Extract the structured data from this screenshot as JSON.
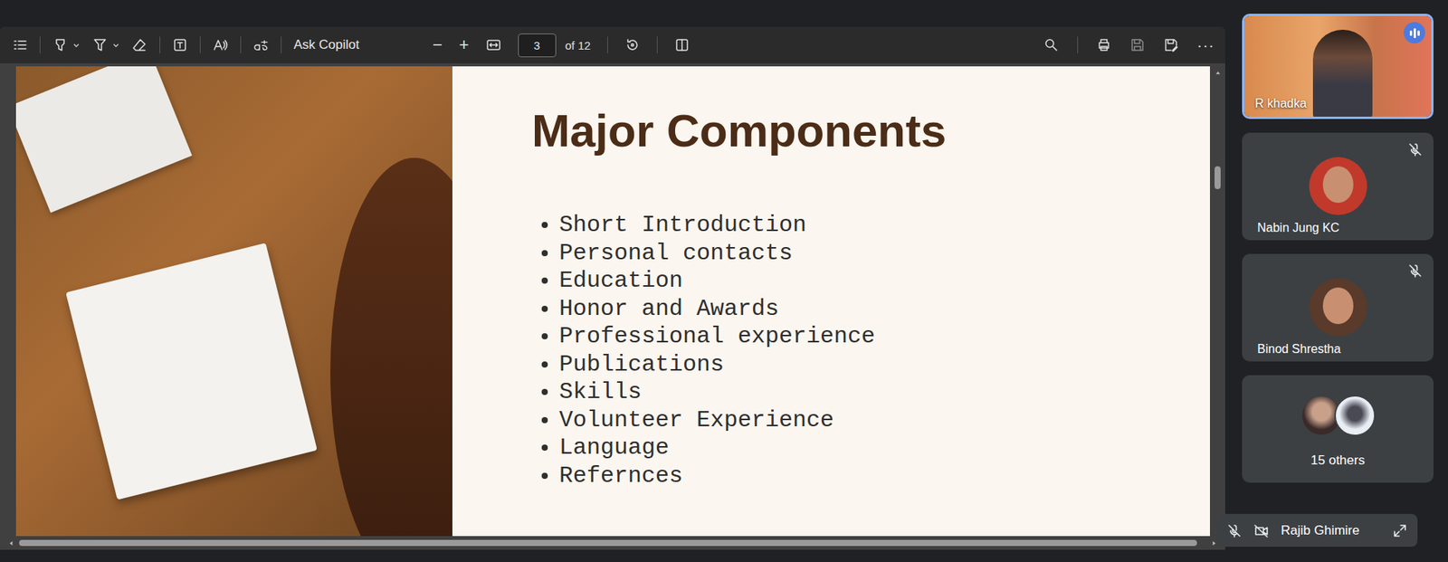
{
  "pdf_toolbar": {
    "ask_copilot": "Ask Copilot",
    "zoom_out": "−",
    "zoom_in": "+",
    "page": "3",
    "page_count": "of 12",
    "more": "···"
  },
  "slide": {
    "title": "Major Components",
    "items": [
      "Short Introduction",
      "Personal contacts",
      "Education",
      "Honor and Awards",
      "Professional experience",
      "Publications",
      "Skills",
      "Volunteer Experience",
      "Language",
      "Refernces"
    ]
  },
  "participants": [
    {
      "name": "R khadka",
      "kind": "video",
      "speaking": true,
      "muted": false
    },
    {
      "name": "Nabin Jung KC",
      "kind": "avatar",
      "speaking": false,
      "muted": true,
      "color": "#c0392b"
    },
    {
      "name": "Binod Shrestha",
      "kind": "avatar",
      "speaking": false,
      "muted": true,
      "color": "#5a3a2a"
    }
  ],
  "others": {
    "label": "15 others"
  },
  "self_view": {
    "name": "Rajib Ghimire",
    "mic_muted": true,
    "camera_off": true
  }
}
